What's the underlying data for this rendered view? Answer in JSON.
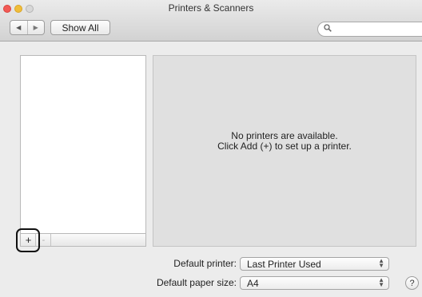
{
  "window": {
    "title": "Printers & Scanners",
    "controls": [
      "close",
      "minimize",
      "zoom"
    ]
  },
  "toolbar": {
    "back_icon": "back-arrow-icon",
    "forward_icon": "forward-arrow-icon",
    "back_glyph": "◀",
    "forward_glyph": "▶",
    "show_all_label": "Show All",
    "search_placeholder": ""
  },
  "printer_list": {
    "items": [],
    "add_glyph": "+",
    "remove_glyph": "-"
  },
  "detail": {
    "message_line1": "No printers are available.",
    "message_line2": "Click Add (+) to set up a printer."
  },
  "settings": {
    "default_printer_label": "Default printer:",
    "default_printer_value": "Last Printer Used",
    "default_paper_label": "Default paper size:",
    "default_paper_value": "A4"
  },
  "help": {
    "glyph": "?"
  },
  "colors": {
    "close": "#f25a55",
    "minimize": "#f0bd3a",
    "zoom": "#d8d8d8",
    "highlight_outline": "#111111"
  }
}
